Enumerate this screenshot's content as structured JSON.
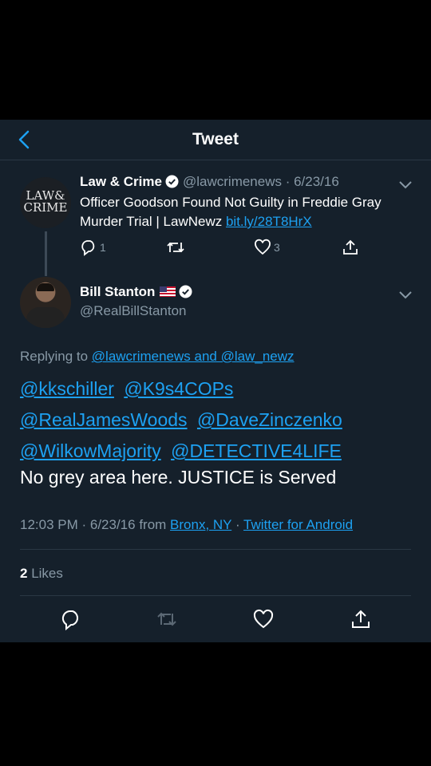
{
  "header": {
    "title": "Tweet"
  },
  "quoted_tweet": {
    "logo_text": "LAW & CRIME",
    "name": "Law & Crime",
    "handle_date": "@lawcrimenews · 6/23/16",
    "text": "Officer Goodson Found Not Guilty in Freddie Gray Murder Trial | LawNewz ",
    "link": "bit.ly/28T8HrX",
    "replies": "1",
    "likes": "3"
  },
  "tweet": {
    "name": "Bill Stanton",
    "flag_icon": "us-flag-icon",
    "handle": "@RealBillStanton",
    "replying_prefix": "Replying to ",
    "replying_to": "@lawcrimenews and @law_newz",
    "mentions": [
      "@kkschiller",
      "@K9s4COPs",
      "@RealJamesWoods",
      "@DaveZinczenko",
      "@WilkowMajority",
      "@DETECTIVE4LIFE"
    ],
    "text": "No grey area here. JUSTICE is Served",
    "time_date": "12:03 PM · 6/23/16 from ",
    "location": "Bronx, NY",
    "separator": " · ",
    "source": "Twitter for Android",
    "likes_count": "2",
    "likes_label": " Likes"
  },
  "colors": {
    "background": "#15202b",
    "link": "#1da1f2",
    "muted": "#8899a6",
    "divider": "#2a3744"
  }
}
